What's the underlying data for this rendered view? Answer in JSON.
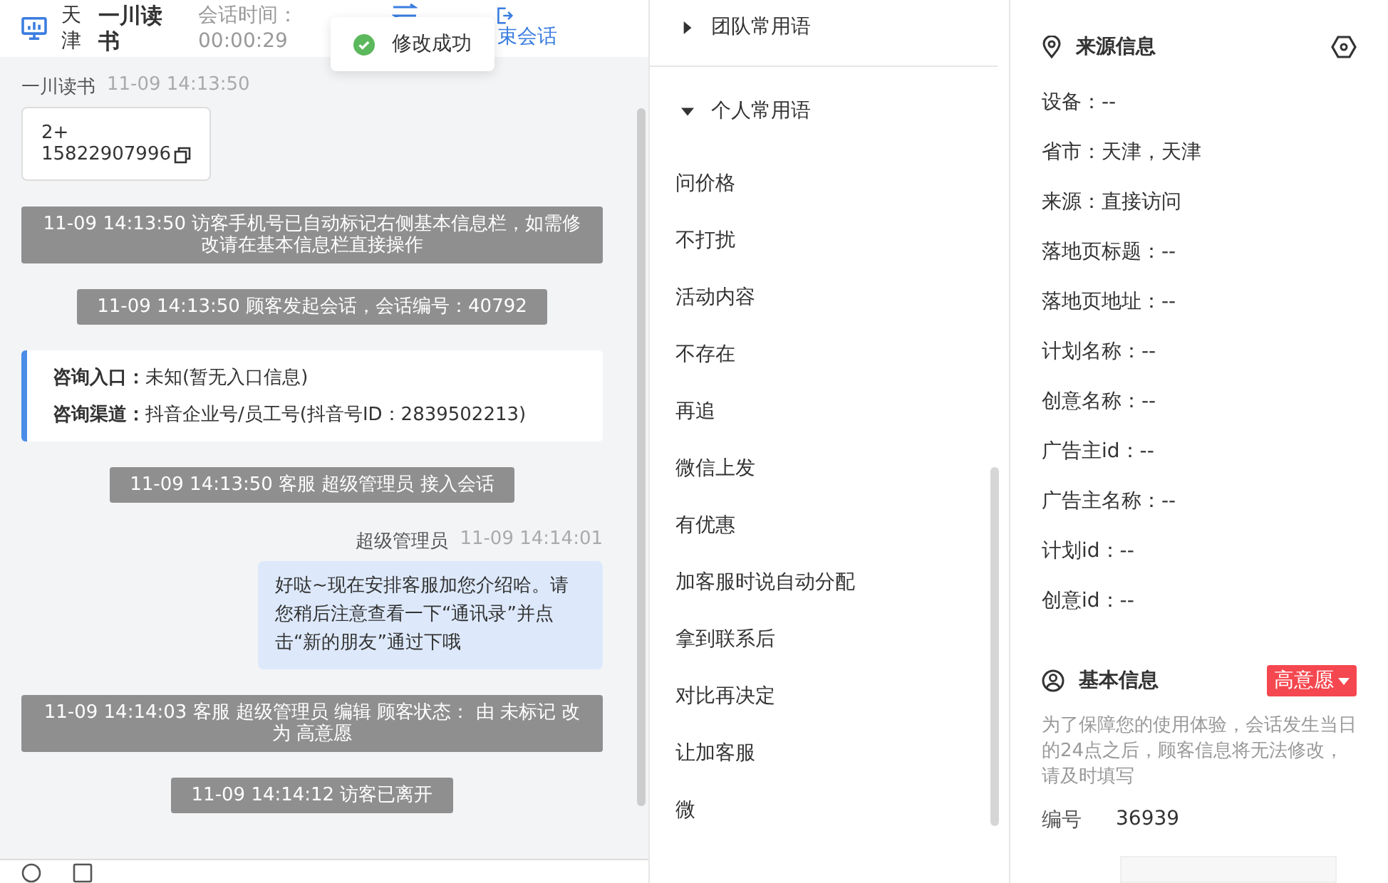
{
  "header": {
    "location": "天津",
    "visitor": "一川读书",
    "timer_label": "会话时间：",
    "timer": "00:00:29",
    "end_label": "束会话"
  },
  "toast": {
    "kind": "success",
    "text": "修改成功"
  },
  "messages": [
    {
      "kind": "visitor",
      "sender": "一川读书",
      "time": "11-09 14:13:50",
      "lines": [
        "2+",
        "15822907996"
      ]
    },
    {
      "kind": "system",
      "text": "11-09 14:13:50 访客手机号已自动标记右侧基本信息栏，如需修改请在基本信息栏直接操作"
    },
    {
      "kind": "system",
      "text": "11-09 14:13:50 顾客发起会话，会话编号：40792"
    },
    {
      "kind": "info",
      "rows": [
        {
          "label": "咨询入口：",
          "value": "未知(暂无入口信息)"
        },
        {
          "label": "咨询渠道：",
          "value": "抖音企业号/员工号(抖音号ID：2839502213)"
        }
      ]
    },
    {
      "kind": "system",
      "text": "11-09 14:13:50 客服 超级管理员 接入会话"
    },
    {
      "kind": "agent",
      "sender": "超级管理员",
      "time": "11-09 14:14:01",
      "text": "好哒~现在安排客服加您介绍哈。请您稍后注意查看一下“通讯录”并点击“新的朋友”通过下哦"
    },
    {
      "kind": "system",
      "text": "11-09 14:14:03 客服 超级管理员 编辑 顾客状态： 由 未标记 改为 高意愿"
    },
    {
      "kind": "system",
      "text": "11-09 14:14:12 访客已离开"
    }
  ],
  "phrase_groups": [
    {
      "title": "团队常用语",
      "expanded": false
    },
    {
      "title": "个人常用语",
      "expanded": true,
      "items": [
        "问价格",
        "不打扰",
        "活动内容",
        "不存在",
        "再追",
        "微信上发",
        "有优惠",
        "加客服时说自动分配",
        "拿到联系后",
        "对比再决定",
        "让加客服",
        "微"
      ]
    }
  ],
  "source_info": {
    "title": "来源信息",
    "fields": [
      "设备：--",
      "省市：天津，天津",
      "来源：直接访问",
      "落地页标题：--",
      "落地页地址：--",
      "计划名称：--",
      "创意名称：--",
      "广告主id：--",
      "广告主名称：--",
      "计划id：--",
      "创意id：--"
    ]
  },
  "basic_info": {
    "title": "基本信息",
    "intent": "高意愿",
    "note": "为了保障您的使用体验，会话发生当日的24点之后，顾客信息将无法修改，请及时填写",
    "id_label": "编号",
    "id_value": "36939"
  }
}
